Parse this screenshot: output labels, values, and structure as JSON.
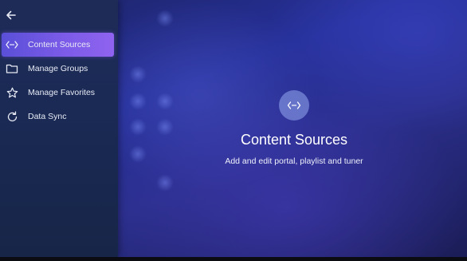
{
  "sidebar": {
    "back_icon": "arrow-left-icon",
    "items": [
      {
        "label": "Content Sources",
        "icon": "code-arrows-icon",
        "active": true
      },
      {
        "label": "Manage Groups",
        "icon": "folder-icon",
        "active": false
      },
      {
        "label": "Manage Favorites",
        "icon": "star-icon",
        "active": false
      },
      {
        "label": "Data Sync",
        "icon": "refresh-icon",
        "active": false
      }
    ]
  },
  "main": {
    "icon": "code-arrows-icon",
    "title": "Content Sources",
    "subtitle": "Add and edit portal, playlist and tuner"
  },
  "colors": {
    "accent": "#7b5be8",
    "sidebar_bg": "#1d2a55",
    "background": "#26309a",
    "text": "#ffffff"
  }
}
